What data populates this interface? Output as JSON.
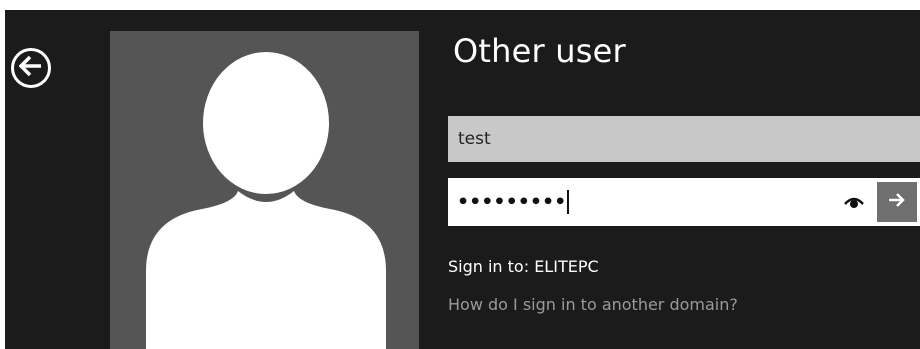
{
  "title": "Other user",
  "username": {
    "value": "test"
  },
  "password": {
    "masked_value": "•••••••••"
  },
  "sign_in_to": "Sign in to: ELITEPC",
  "other_domain_link": "How do I sign in to another domain?",
  "icons": {
    "back": "arrow-left-circle",
    "reveal": "eye",
    "submit": "arrow-right",
    "avatar": "person-silhouette"
  },
  "colors": {
    "background": "#1b1b1b",
    "tile": "#555555",
    "username_field": "#c8c8c8",
    "submit_button": "#6f6f6f",
    "link": "#9a9a9a"
  }
}
